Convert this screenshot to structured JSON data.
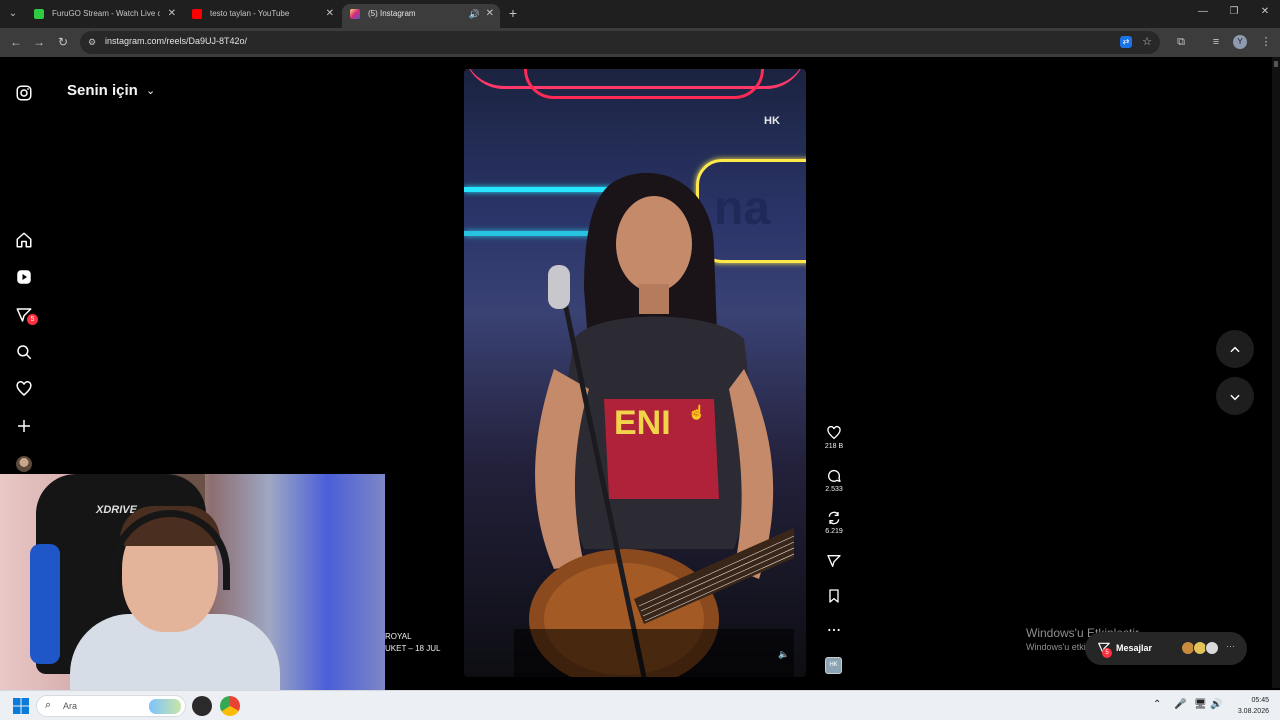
{
  "browser": {
    "tabs": [
      {
        "title": "FuruGO Stream - Watch Live o",
        "favicon_color": "#2ecc40",
        "active": false
      },
      {
        "title": "testo taylan - YouTube",
        "favicon_color": "#ff0000",
        "active": false
      },
      {
        "title": "(5) Instagram",
        "favicon_color": "#d6249f",
        "active": true
      }
    ],
    "url": "instagram.com/reels/Da9UJ-8T42o/"
  },
  "instagram": {
    "feed_title": "Senin için",
    "notifications_badge": "5",
    "reel": {
      "watermark": "HK",
      "sign_text": "na",
      "likes": "218 B",
      "comments": "2.533",
      "reposts": "6.219"
    },
    "caption_lines": [
      "ROYAL",
      "UKET – 18 JUL"
    ],
    "messages": {
      "label": "Mesajlar",
      "badge": "5"
    }
  },
  "windows": {
    "activate_title": "Windows'u Etkinleştir",
    "activate_subtitle": "Windows'u etkinleştirmek için Ayarlar'a gidin.",
    "search_placeholder": "Ara",
    "time": "05:45",
    "date": "3.08.2026"
  },
  "webcam": {
    "chair_logo": "XDRIVE"
  }
}
